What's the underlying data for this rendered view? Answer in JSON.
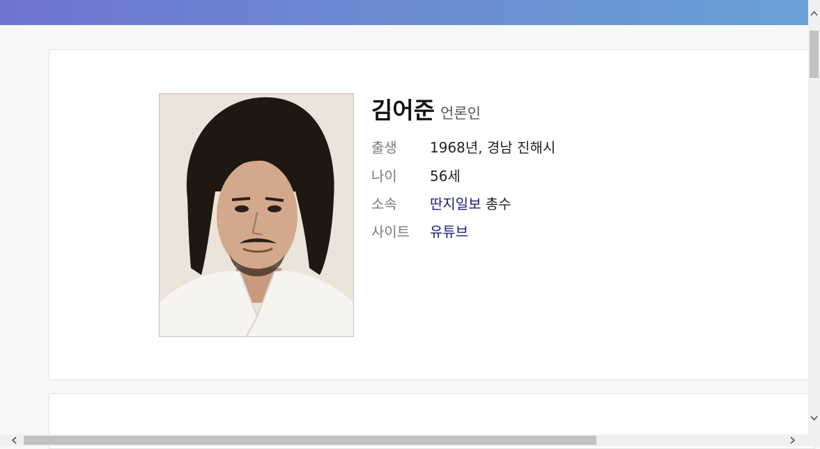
{
  "profile": {
    "name": "김어준",
    "occupation": "언론인",
    "photo_icon": "portrait-photo",
    "rows": [
      {
        "label": "출생",
        "value": "1968년, 경남 진해시"
      },
      {
        "label": "나이",
        "value": "56세"
      },
      {
        "label": "소속",
        "link": "딴지일보",
        "suffix": " 총수"
      },
      {
        "label": "사이트",
        "link": "유튜브"
      }
    ]
  },
  "scrollbars": {
    "up_arrow": "^",
    "down_arrow": "v",
    "left_arrow": "<",
    "right_arrow": ">"
  },
  "colors": {
    "header_gradient_start": "#6f74cf",
    "header_gradient_end": "#69a0d6",
    "link": "#1a1a7a"
  }
}
